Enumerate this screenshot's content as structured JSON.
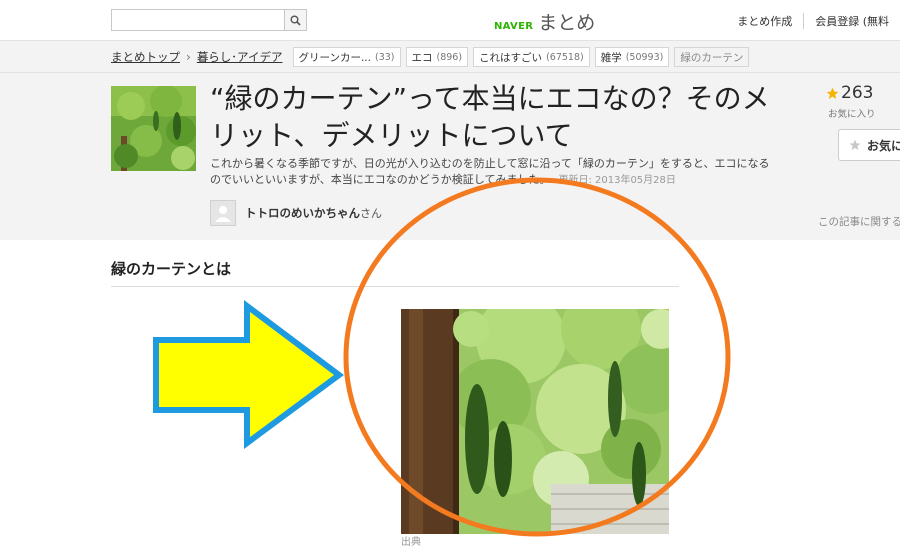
{
  "header": {
    "search": {
      "value": "",
      "placeholder": ""
    },
    "search_icon": "search-icon",
    "logo_naver": "NAVER",
    "logo_matome": "まとめ",
    "links": [
      "まとめ作成",
      "会員登録 (無料"
    ]
  },
  "breadcrumb": {
    "top": "まとめトップ",
    "category": "暮らし･アイデア",
    "tags": [
      {
        "label": "グリーンカー...",
        "count": "(33)"
      },
      {
        "label": "エコ",
        "count": "(896)"
      },
      {
        "label": "これはすごい",
        "count": "(67518)"
      },
      {
        "label": "雑学",
        "count": "(50993)"
      }
    ],
    "current": "緑のカーテン"
  },
  "article": {
    "title": "“緑のカーテン”って本当にエコなの？そのメリット、デメリットについて",
    "description": "これから暑くなる季節ですが、日の光が入り込むのを防止して窓に沿って「緑のカーテン」をすると、エコになるのでいいといいますが、本当にエコなのかどうか検証してみました。",
    "updated": "更新日: 2013年05月28日",
    "author_name": "トトロのめいかちゃん",
    "author_suffix": "さん",
    "favorites_count": "263",
    "favorites_label": "お気に入り",
    "favorite_button": "お気に",
    "related_link": "この記事に関する"
  },
  "section": {
    "title": "緑のカーテンとは",
    "caption": "出典"
  },
  "colors": {
    "naver_green": "#2db400",
    "annotation_arrow_fill": "#ffff00",
    "annotation_arrow_stroke": "#1e9be0",
    "annotation_ellipse": "#f47a20",
    "star": "#f5b400"
  }
}
